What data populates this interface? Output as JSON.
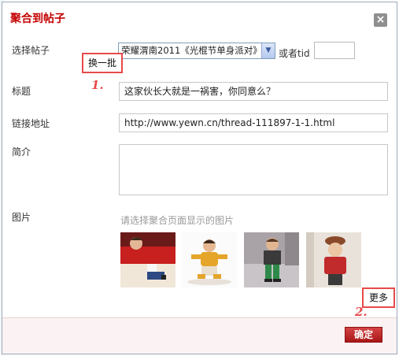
{
  "dialog": {
    "title": "聚合到帖子",
    "close_glyph": "×",
    "close_icon": "close-icon"
  },
  "fields": {
    "select_post_label": "选择帖子",
    "select_post_value": "荣耀渭南2011《光棍节单身派对》",
    "or_tid_label": "或者tid",
    "tid_value": "",
    "swap_batch_label": "换一批",
    "title_label": "标题",
    "title_value": "这家伙长大就是一祸害，你同意么？",
    "link_label": "链接地址",
    "link_value": "http://www.yewn.cn/thread-111897-1-1.html",
    "intro_label": "简介",
    "intro_value": "",
    "image_label": "图片",
    "image_hint": "请选择聚合页面显示的图片"
  },
  "images": [
    {
      "name": "thumbnail-1",
      "icon": "child-photo"
    },
    {
      "name": "thumbnail-2",
      "icon": "child-photo"
    },
    {
      "name": "thumbnail-3",
      "icon": "child-photo"
    },
    {
      "name": "thumbnail-4",
      "icon": "child-photo"
    }
  ],
  "annotations": {
    "step1": "1.",
    "step2": "2."
  },
  "actions": {
    "more_label": "更多",
    "confirm_label": "确定"
  },
  "colors": {
    "title": "#c40000",
    "annotation": "#e74a4a",
    "confirm_button": "#c42a2a"
  }
}
